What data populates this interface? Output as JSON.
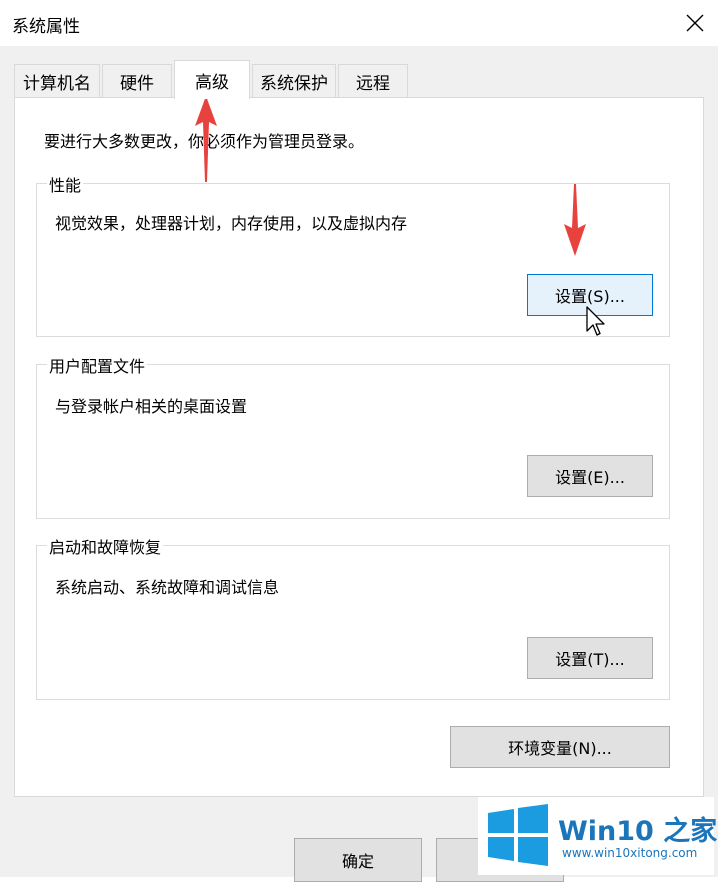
{
  "window": {
    "title": "系统属性"
  },
  "tabs": [
    {
      "label": "计算机名",
      "active": false
    },
    {
      "label": "硬件",
      "active": false
    },
    {
      "label": "高级",
      "active": true
    },
    {
      "label": "系统保护",
      "active": false
    },
    {
      "label": "远程",
      "active": false
    }
  ],
  "admin_note": "要进行大多数更改，你必须作为管理员登录。",
  "groups": {
    "performance": {
      "title": "性能",
      "description": "视觉效果，处理器计划，内存使用，以及虚拟内存",
      "button": "设置(S)..."
    },
    "user_profiles": {
      "title": "用户配置文件",
      "description": "与登录帐户相关的桌面设置",
      "button": "设置(E)..."
    },
    "startup_recovery": {
      "title": "启动和故障恢复",
      "description": "系统启动、系统故障和调试信息",
      "button": "设置(T)..."
    }
  },
  "env_button": "环境变量(N)...",
  "dialog_buttons": {
    "ok": "确定"
  },
  "watermark": {
    "brand": "Win10 之家",
    "url": "www.win10xitong.com"
  },
  "colors": {
    "arrow": "#e8423e",
    "hover_border": "#0078d7",
    "brand_blue": "#1b75bb"
  },
  "icons": [
    "close-icon",
    "red-arrow-up-icon",
    "red-arrow-down-icon",
    "mouse-cursor-icon",
    "windows-logo-icon"
  ]
}
